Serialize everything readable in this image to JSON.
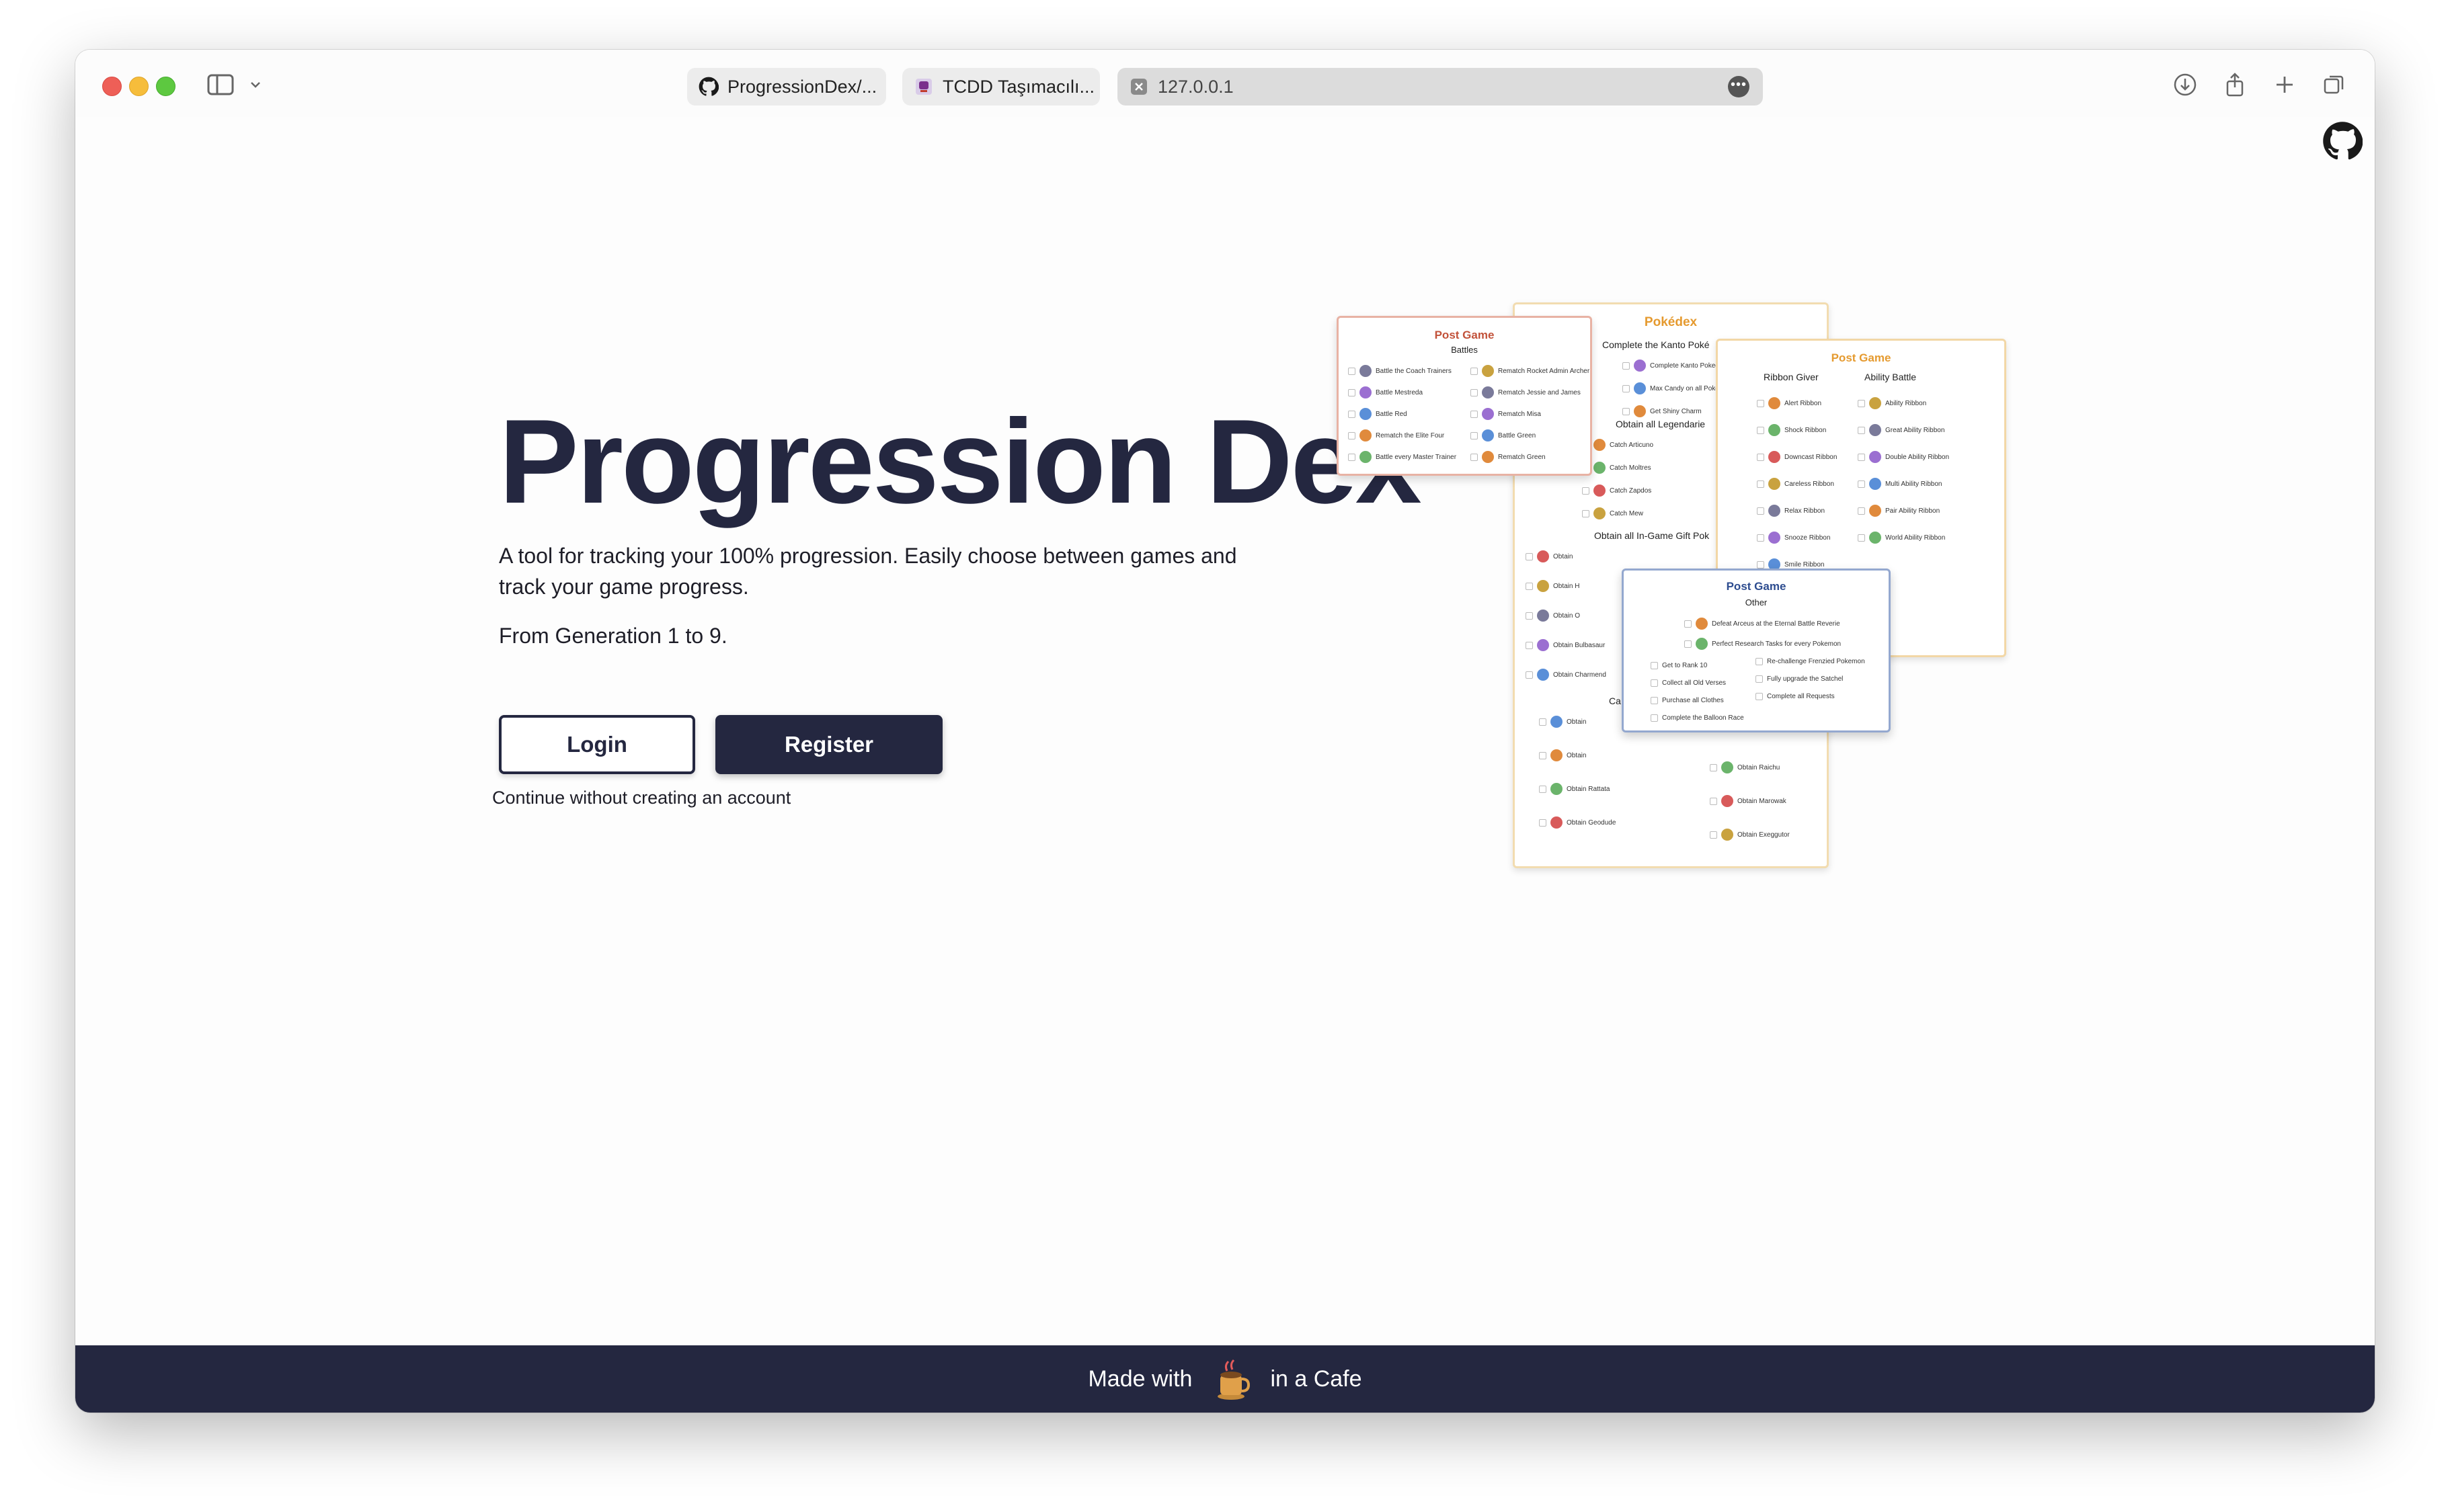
{
  "browser": {
    "tabs": [
      {
        "label": "ProgressionDex/...",
        "icon": "github-icon"
      },
      {
        "label": "TCDD Taşımacılı...",
        "icon": "train-icon"
      },
      {
        "label": "127.0.0.1",
        "icon": "close-icon",
        "active": true
      }
    ]
  },
  "hero": {
    "title": "Progression Dex",
    "description": "A tool for tracking your 100% progression. Easily choose between games and track your game progress.",
    "generations": "From Generation 1 to 9.",
    "login_label": "Login",
    "register_label": "Register",
    "continue_label": "Continue without creating an account"
  },
  "preview": {
    "dex": {
      "title": "Pokédex",
      "section1": "Complete the Kanto Poké",
      "items1": [
        "Complete Kanto Pokedex",
        "Max Candy on all Poke",
        "Get Shiny Charm"
      ],
      "section2": "Obtain all Legendarie",
      "items2": [
        "Catch Articuno",
        "Catch Moltres",
        "Catch Zapdos",
        "Catch Mew"
      ],
      "section3": "Obtain all In-Game Gift Pok",
      "items3": [
        "Obtain",
        "Obtain H",
        "Obtain O",
        "Obtain Bulbasaur",
        "Obtain Charmend"
      ],
      "section4": "Ca",
      "items4_left": [
        "Obtain",
        "Obtain",
        "Obtain Rattata",
        "Obtain Geodude"
      ],
      "items4_right": [
        "Obtain Raichu",
        "Obtain Marowak",
        "Obtain Exeggutor"
      ]
    },
    "battles": {
      "title": "Post Game",
      "subtitle": "Battles",
      "left": [
        "Battle the Coach Trainers",
        "Battle Mestreda",
        "Battle Red",
        "Rematch the Elite Four",
        "Battle every Master Trainer"
      ],
      "right": [
        "Rematch Rocket Admin Archer",
        "Rematch Jessie and James",
        "Rematch Misa",
        "Battle Green",
        "Rematch Green"
      ]
    },
    "ribbons": {
      "title": "Post Game",
      "col1": "Ribbon Giver",
      "col2": "Ability Battle",
      "left": [
        "Alert Ribbon",
        "Shock Ribbon",
        "Downcast Ribbon",
        "Careless Ribbon",
        "Relax Ribbon",
        "Snooze Ribbon",
        "Smile Ribbon"
      ],
      "right": [
        "Ability Ribbon",
        "Great Ability Ribbon",
        "Double Ability Ribbon",
        "Multi Ability Ribbon",
        "Pair Ability Ribbon",
        "World Ability Ribbon"
      ]
    },
    "other": {
      "title": "Post Game",
      "subtitle": "Other",
      "items": [
        "Defeat Arceus at the Eternal Battle Reverie",
        "Perfect Research Tasks for every Pokemon"
      ],
      "left": [
        "Get to Rank 10",
        "Collect all Old Verses",
        "Purchase all Clothes",
        "Complete the Balloon Race"
      ],
      "right": [
        "Re-challenge Frenzied Pokemon",
        "Fully upgrade the Satchel",
        "Complete all Requests"
      ]
    }
  },
  "footer": {
    "before": "Made with",
    "after": "in a Cafe",
    "icon": "coffee-mug-icon"
  },
  "colors": {
    "navy": "#242740",
    "orange": "#e59a2f",
    "blue": "#2d4c8f",
    "red_title": "#c2523a"
  }
}
